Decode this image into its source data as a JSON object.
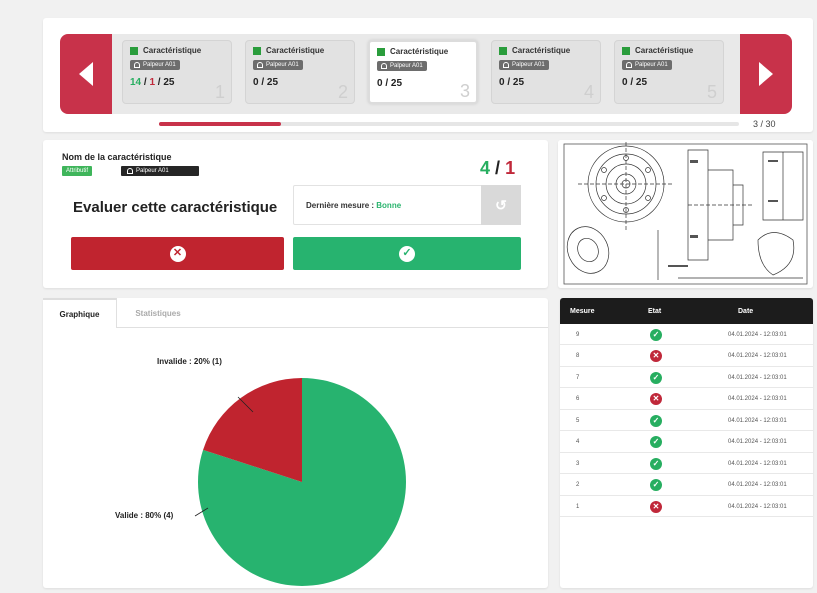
{
  "carousel": {
    "cards": [
      {
        "title": "Caractéristique",
        "probe": "Palpeur A01",
        "count_valid": "14",
        "count_invalid": "1",
        "count_total": "25",
        "number": "1"
      },
      {
        "title": "Caractéristique",
        "probe": "Palpeur A01",
        "count_text": "0 / 25",
        "number": "2"
      },
      {
        "title": "Caractéristique",
        "probe": "Palpeur A01",
        "count_text": "0 / 25",
        "number": "3"
      },
      {
        "title": "Caractéristique",
        "probe": "Palpeur A01",
        "count_text": "0 / 25",
        "number": "4"
      },
      {
        "title": "Caractéristique",
        "probe": "Palpeur A01",
        "count_text": "0 / 25",
        "number": "5"
      }
    ],
    "active_index": 3,
    "pager": "3 / 30"
  },
  "evaluation": {
    "char_name": "Nom de la caractéristique",
    "tag_attribute": "Attributif",
    "tag_probe": "Palpeur A01",
    "score_valid": "4",
    "score_sep": "/",
    "score_invalid": "1",
    "title": "Evaluer cette caractéristique",
    "last_label": "Dernière mesure : ",
    "last_value": "Bonne"
  },
  "chart_tabs": {
    "graph": "Graphique",
    "stats": "Statistiques"
  },
  "chart_data": {
    "type": "pie",
    "slices": [
      {
        "label": "Valide : 80% (4)",
        "value": 4,
        "percent": 80,
        "color": "#27b36f"
      },
      {
        "label": "Invalide : 20% (1)",
        "value": 1,
        "percent": 20,
        "color": "#c0242f"
      }
    ]
  },
  "table": {
    "headers": {
      "measure": "Mesure",
      "state": "Etat",
      "date": "Date"
    },
    "rows": [
      {
        "measure": "9",
        "ok": true,
        "date": "04.01.2024 - 12:03:01"
      },
      {
        "measure": "8",
        "ok": false,
        "date": "04.01.2024 - 12:03:01"
      },
      {
        "measure": "7",
        "ok": true,
        "date": "04.01.2024 - 12:03:01"
      },
      {
        "measure": "6",
        "ok": false,
        "date": "04.01.2024 - 12:03:01"
      },
      {
        "measure": "5",
        "ok": true,
        "date": "04.01.2024 - 12:03:01"
      },
      {
        "measure": "4",
        "ok": true,
        "date": "04.01.2024 - 12:03:01"
      },
      {
        "measure": "3",
        "ok": true,
        "date": "04.01.2024 - 12:03:01"
      },
      {
        "measure": "2",
        "ok": true,
        "date": "04.01.2024 - 12:03:01"
      },
      {
        "measure": "1",
        "ok": false,
        "date": "04.01.2024 - 12:03:01"
      }
    ]
  },
  "colors": {
    "accent": "#c8324a",
    "valid": "#27b36f",
    "invalid": "#c0242f"
  }
}
